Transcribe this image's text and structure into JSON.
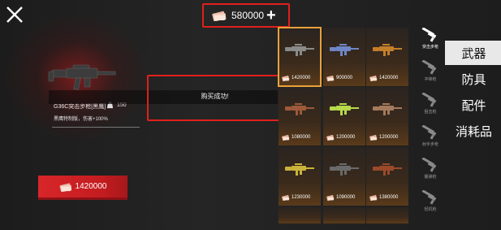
{
  "currency": {
    "amount": "580000",
    "plus_symbol": "+"
  },
  "selected_item": {
    "name": "G36C突击步枪[黑鹰]",
    "weight": "150",
    "description": "黑鹰特制版，伤害+100%",
    "price": "1420000"
  },
  "toast": {
    "message": "购买成功!"
  },
  "grid": {
    "items": [
      {
        "price": "1420000",
        "tint": "#8a8a8a",
        "selected": true
      },
      {
        "price": "900000",
        "tint": "#6f86c7",
        "selected": false
      },
      {
        "price": "1420000",
        "tint": "#c47f2a",
        "selected": false
      },
      {
        "price": "1080000",
        "tint": "#9c5a3a",
        "selected": false
      },
      {
        "price": "1200000",
        "tint": "#b7d94a",
        "selected": false
      },
      {
        "price": "1200000",
        "tint": "#a47a5c",
        "selected": false
      },
      {
        "price": "1230000",
        "tint": "#c9b23a",
        "selected": false
      },
      {
        "price": "1090000",
        "tint": "#6a6a6a",
        "selected": false
      },
      {
        "price": "1380000",
        "tint": "#9a4a2a",
        "selected": false
      }
    ]
  },
  "subcategories": [
    {
      "label": "突击步枪",
      "active": true
    },
    {
      "label": "冲锋枪",
      "active": false
    },
    {
      "label": "狙击枪",
      "active": false
    },
    {
      "label": "射手步枪",
      "active": false
    },
    {
      "label": "霰弹枪",
      "active": false
    },
    {
      "label": "轻机枪",
      "active": false
    }
  ],
  "tabs": [
    {
      "label": "武器",
      "active": true
    },
    {
      "label": "防具",
      "active": false
    },
    {
      "label": "配件",
      "active": false
    },
    {
      "label": "消耗品",
      "active": false
    }
  ],
  "colors": {
    "accent_red": "#e0201c",
    "selected_gold": "#e8a23a",
    "buy_red": "#d8262a"
  }
}
